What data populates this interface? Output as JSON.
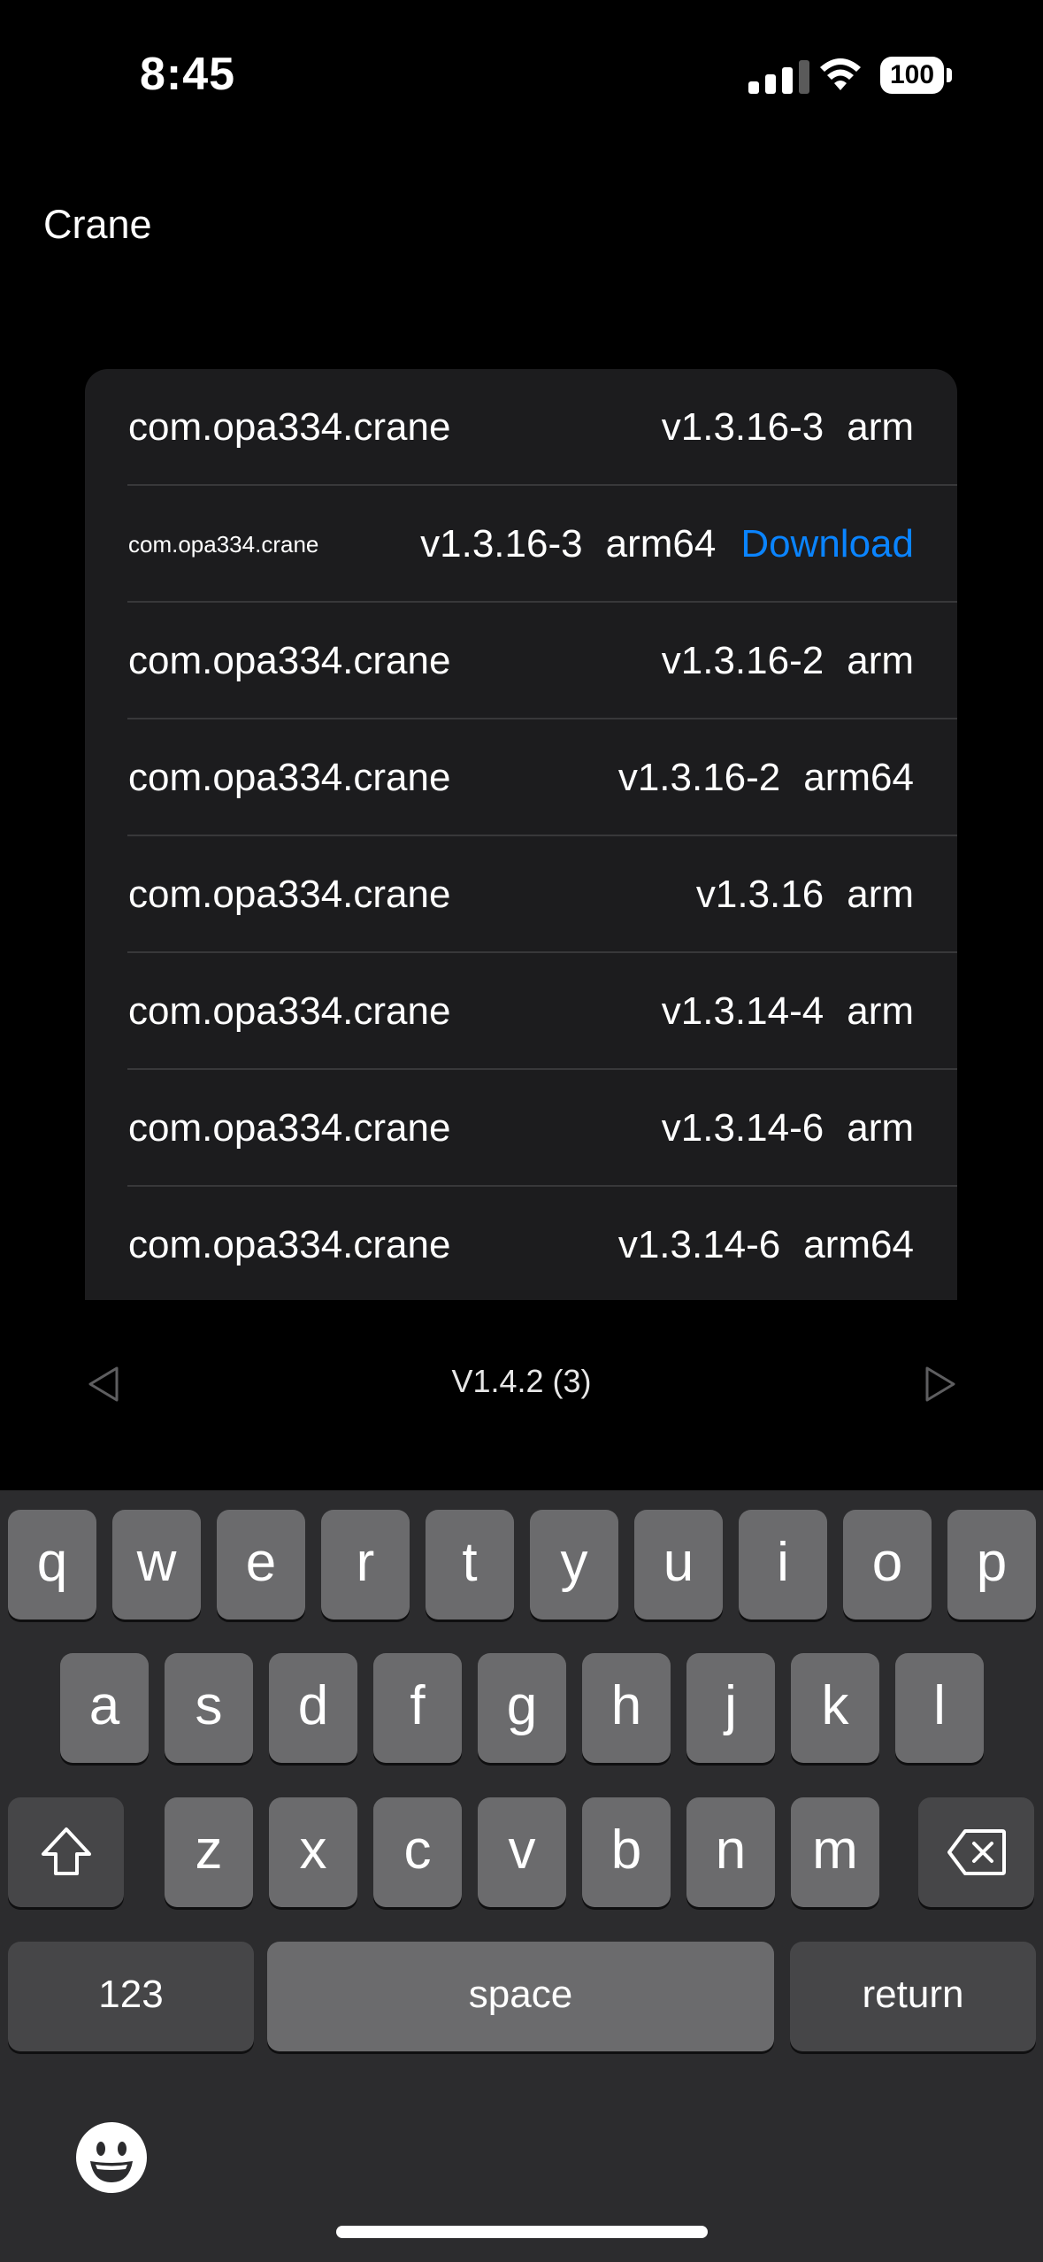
{
  "status_bar": {
    "time": "8:45",
    "battery": "100"
  },
  "app": {
    "title": "Crane"
  },
  "list": {
    "rows": [
      {
        "package": "com.opa334.crane",
        "version": "v1.3.16-3",
        "arch": "arm",
        "action": ""
      },
      {
        "package": "com.opa334.crane",
        "version": "v1.3.16-3",
        "arch": "arm64",
        "action": "Download"
      },
      {
        "package": "com.opa334.crane",
        "version": "v1.3.16-2",
        "arch": "arm",
        "action": ""
      },
      {
        "package": "com.opa334.crane",
        "version": "v1.3.16-2",
        "arch": "arm64",
        "action": ""
      },
      {
        "package": "com.opa334.crane",
        "version": "v1.3.16",
        "arch": "arm",
        "action": ""
      },
      {
        "package": "com.opa334.crane",
        "version": "v1.3.14-4",
        "arch": "arm",
        "action": ""
      },
      {
        "package": "com.opa334.crane",
        "version": "v1.3.14-6",
        "arch": "arm",
        "action": ""
      },
      {
        "package": "com.opa334.crane",
        "version": "v1.3.14-6",
        "arch": "arm64",
        "action": ""
      }
    ]
  },
  "pager": {
    "label": "V1.4.2 (3)"
  },
  "keyboard": {
    "row1": [
      "q",
      "w",
      "e",
      "r",
      "t",
      "y",
      "u",
      "i",
      "o",
      "p"
    ],
    "row2": [
      "a",
      "s",
      "d",
      "f",
      "g",
      "h",
      "j",
      "k",
      "l"
    ],
    "row3": [
      "z",
      "x",
      "c",
      "v",
      "b",
      "n",
      "m"
    ],
    "numbers_label": "123",
    "space_label": "space",
    "return_label": "return"
  },
  "icons": {
    "signal": "cellular-signal-icon",
    "wifi": "wifi-icon",
    "battery": "battery-icon",
    "prev": "triangle-left-icon",
    "next": "triangle-right-icon",
    "shift": "shift-arrow-icon",
    "delete": "delete-backspace-icon",
    "emoji": "emoji-face-icon"
  },
  "colors": {
    "accent": "#0a84ff",
    "card": "#1c1c1e",
    "keyboard": "#2c2c2e"
  }
}
